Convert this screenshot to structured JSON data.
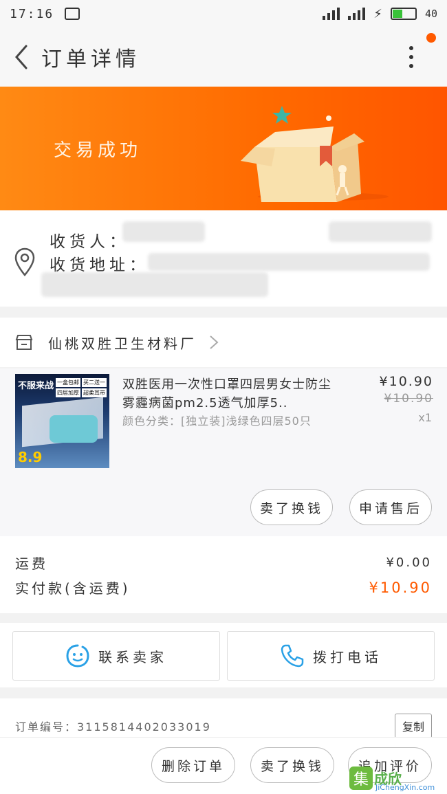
{
  "status_bar": {
    "time": "17:16",
    "battery": "40",
    "battery_level": 0.45,
    "net_label": "4G"
  },
  "header": {
    "title": "订单详情"
  },
  "banner": {
    "status": "交易成功",
    "accent": "#ff6a00"
  },
  "address": {
    "receiver_label": "收货人：",
    "address_label": "收货地址："
  },
  "shop": {
    "name": "仙桃双胜卫生材料厂"
  },
  "product": {
    "title": "双胜医用一次性口罩四层男女士防尘雾霾病菌pm2.5透气加厚5..",
    "variant": "颜色分类：[独立装]浅绿色四层50只",
    "price": "¥10.90",
    "original_price": "¥10.90",
    "quantity": "x1",
    "thumb": {
      "headline": "不服来战",
      "tags": [
        "一盒包邮",
        "买二送一",
        "四层加厚",
        "超柔耳带"
      ],
      "price": "8.9"
    },
    "buttons": {
      "resell": "卖了换钱",
      "after_sale": "申请售后"
    }
  },
  "fees": {
    "shipping_label": "运费",
    "shipping_value": "¥0.00",
    "paid_label": "实付款(含运费)",
    "paid_value": "¥10.90"
  },
  "contact": {
    "seller": "联系卖家",
    "call": "拨打电话"
  },
  "order": {
    "number_text": "订单编号：3115814402033019",
    "copy": "复制"
  },
  "bottom_bar": {
    "delete": "删除订单",
    "resell": "卖了换钱",
    "review": "追加评价"
  },
  "watermark": {
    "logo": "集",
    "text": "成欣",
    "url": "JiChengXin.com"
  },
  "icons": {
    "back": "back-arrow-icon",
    "more": "more-vertical-icon",
    "location": "location-pin-icon",
    "store": "store-icon",
    "chevron": "chevron-right-icon",
    "chat": "chat-smile-icon",
    "phone": "phone-icon"
  }
}
